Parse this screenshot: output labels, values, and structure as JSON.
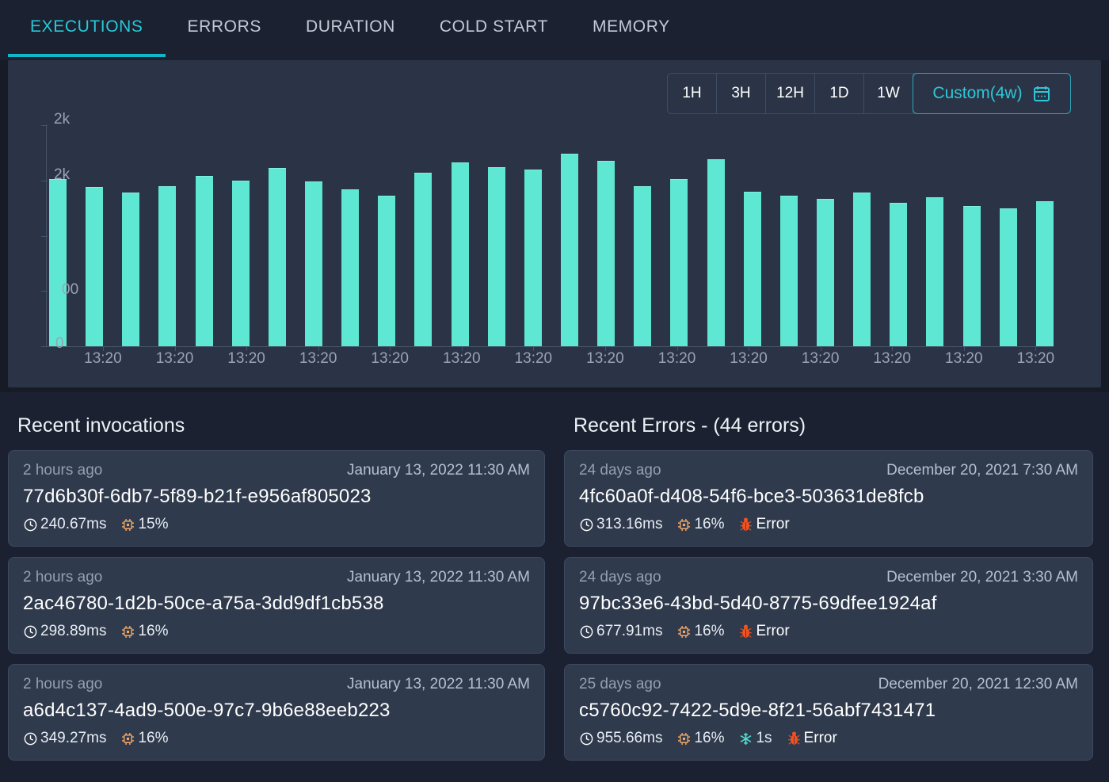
{
  "tabs": [
    {
      "label": "EXECUTIONS",
      "active": true
    },
    {
      "label": "ERRORS",
      "active": false
    },
    {
      "label": "DURATION",
      "active": false
    },
    {
      "label": "COLD START",
      "active": false
    },
    {
      "label": "MEMORY",
      "active": false
    }
  ],
  "time_range": {
    "options": [
      "1H",
      "3H",
      "12H",
      "1D",
      "1W"
    ],
    "custom_label": "Custom(4w)",
    "calendar_icon": "calendar-icon",
    "selected": "Custom(4w)"
  },
  "chart_data": {
    "type": "bar",
    "title": "",
    "xlabel": "",
    "ylabel": "",
    "ylim": [
      0,
      2000
    ],
    "grid": false,
    "legend": "none",
    "y_ticks": [
      "2k",
      "2k",
      "00",
      "0"
    ],
    "y_tick_values": [
      2000,
      1500,
      1000,
      500,
      0
    ],
    "x_tick_label": "13:20",
    "x_tick_labels": [
      "13:20",
      "13:20",
      "13:20",
      "13:20",
      "13:20",
      "13:20",
      "13:20",
      "13:20",
      "13:20",
      "13:20",
      "13:20",
      "13:20",
      "13:20",
      "13:20"
    ],
    "categories": [
      "13:20",
      "13:20",
      "13:20",
      "13:20",
      "13:20",
      "13:20",
      "13:20",
      "13:20",
      "13:20",
      "13:20",
      "13:20",
      "13:20",
      "13:20",
      "13:20",
      "13:20",
      "13:20",
      "13:20",
      "13:20",
      "13:20",
      "13:20",
      "13:20",
      "13:20",
      "13:20",
      "13:20",
      "13:20",
      "13:20",
      "13:20",
      "13:20"
    ],
    "values": [
      1510,
      1440,
      1390,
      1450,
      1540,
      1500,
      1610,
      1490,
      1420,
      1360,
      1570,
      1660,
      1620,
      1600,
      1740,
      1680,
      1450,
      1510,
      1690,
      1400,
      1360,
      1330,
      1390,
      1300,
      1350,
      1270,
      1250,
      1310
    ],
    "bar_color": "#5ee7d3",
    "axis_color": "#46536a",
    "label_color": "#98a3b5"
  },
  "invocations": {
    "title": "Recent invocations",
    "items": [
      {
        "relative_time": "2 hours ago",
        "absolute_time": "January 13, 2022 11:30 AM",
        "id": "77d6b30f-6db7-5f89-b21f-e956af805023",
        "duration": "240.67ms",
        "memory": "15%",
        "cold_start": null,
        "status": null
      },
      {
        "relative_time": "2 hours ago",
        "absolute_time": "January 13, 2022 11:30 AM",
        "id": "2ac46780-1d2b-50ce-a75a-3dd9df1cb538",
        "duration": "298.89ms",
        "memory": "16%",
        "cold_start": null,
        "status": null
      },
      {
        "relative_time": "2 hours ago",
        "absolute_time": "January 13, 2022 11:30 AM",
        "id": "a6d4c137-4ad9-500e-97c7-9b6e88eeb223",
        "duration": "349.27ms",
        "memory": "16%",
        "cold_start": null,
        "status": null
      }
    ]
  },
  "errors": {
    "title": "Recent Errors - (44 errors)",
    "count": 44,
    "items": [
      {
        "relative_time": "24 days ago",
        "absolute_time": "December 20, 2021 7:30 AM",
        "id": "4fc60a0f-d408-54f6-bce3-503631de8fcb",
        "duration": "313.16ms",
        "memory": "16%",
        "cold_start": null,
        "status": "Error"
      },
      {
        "relative_time": "24 days ago",
        "absolute_time": "December 20, 2021 3:30 AM",
        "id": "97bc33e6-43bd-5d40-8775-69dfee1924af",
        "duration": "677.91ms",
        "memory": "16%",
        "cold_start": null,
        "status": "Error"
      },
      {
        "relative_time": "25 days ago",
        "absolute_time": "December 20, 2021 12:30 AM",
        "id": "c5760c92-7422-5d9e-8f21-56abf7431471",
        "duration": "955.66ms",
        "memory": "16%",
        "cold_start": "1s",
        "status": "Error"
      }
    ]
  },
  "colors": {
    "accent": "#2ec7d6",
    "bar": "#5ee7d3",
    "memory": "#f0a868",
    "error": "#f4511e",
    "cold": "#4fdfd0",
    "panel": "#2b3446",
    "card": "#2f3a4d",
    "page": "#1b2130"
  },
  "icons": {
    "clock": "clock-icon",
    "cpu": "cpu-icon",
    "snowflake": "snowflake-icon",
    "bug": "bug-icon",
    "calendar": "calendar-icon"
  }
}
